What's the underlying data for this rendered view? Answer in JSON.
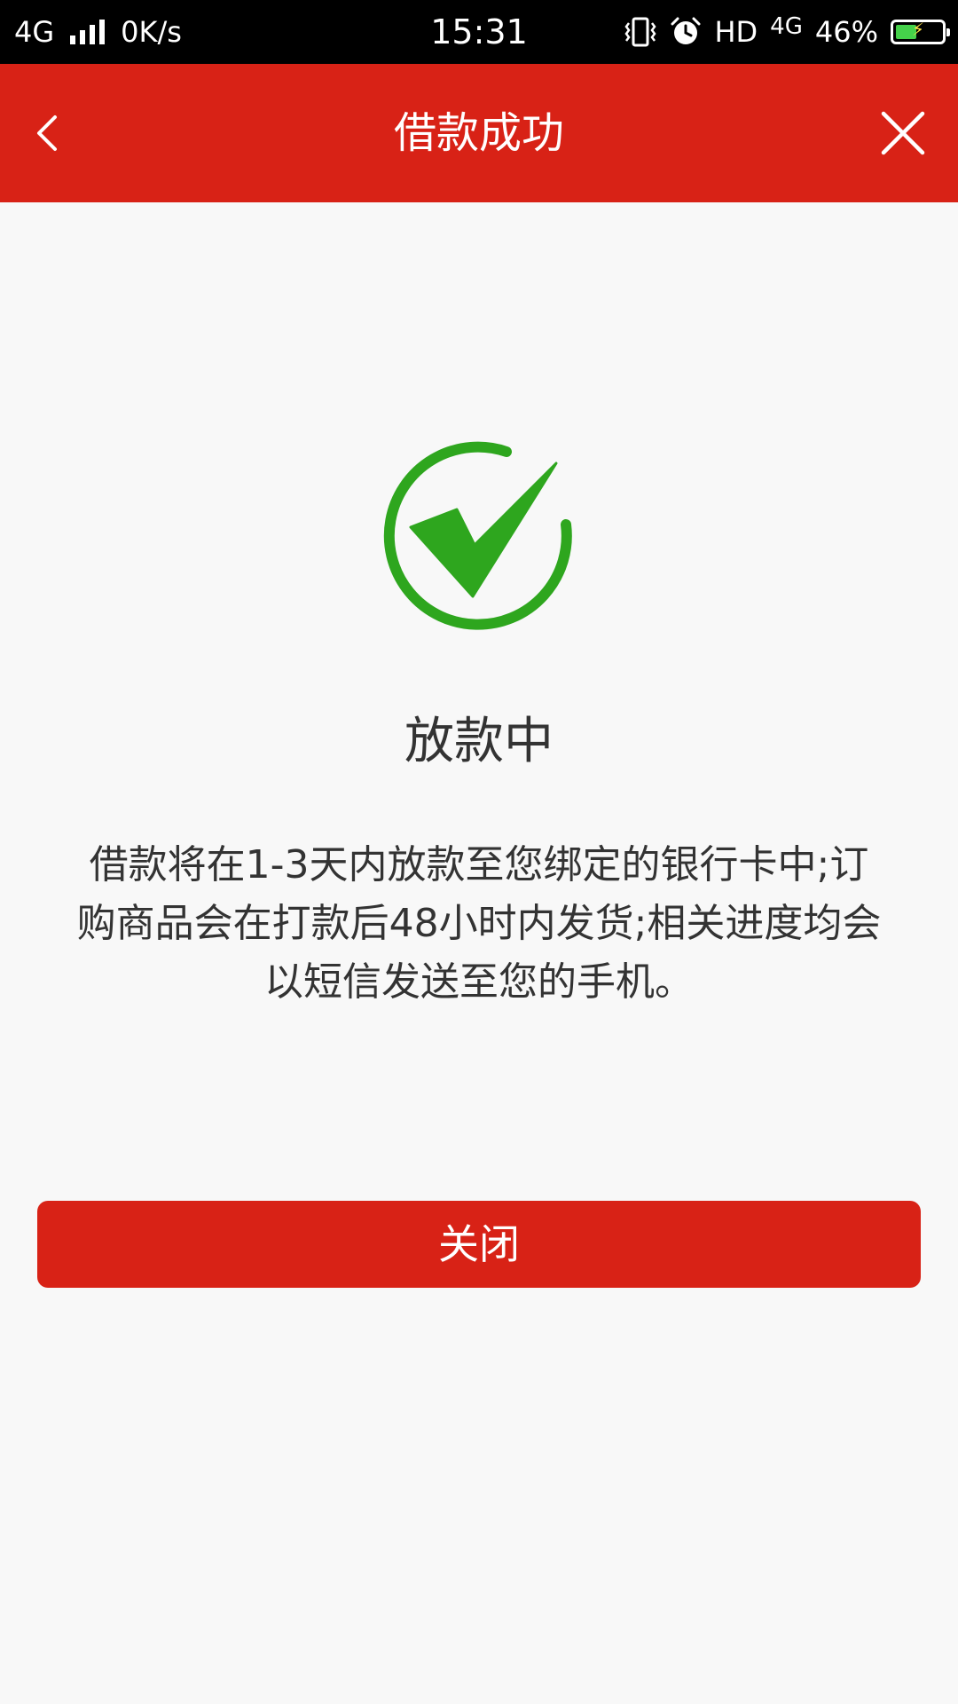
{
  "status_bar": {
    "network_left": "4G",
    "speed": "0K/s",
    "time": "15:31",
    "hd": "HD",
    "network_right": "4G",
    "battery": "46%",
    "battery_level": 0.46,
    "icons": [
      "signal-icon",
      "vibrate-icon",
      "alarm-icon",
      "battery-icon"
    ]
  },
  "header": {
    "title": "借款成功",
    "back_icon": "chevron-left-icon",
    "close_icon": "close-icon",
    "background": "#d82216"
  },
  "main": {
    "icon": "check-circle-icon",
    "icon_color": "#2ea61e",
    "heading": "放款中",
    "description": "借款将在1-3天内放款至您绑定的银行卡中;订购商品会在打款后48小时内发货;相关进度均会以短信发送至您的手机。"
  },
  "actions": {
    "close_label": "关闭",
    "button_color": "#d82216"
  }
}
